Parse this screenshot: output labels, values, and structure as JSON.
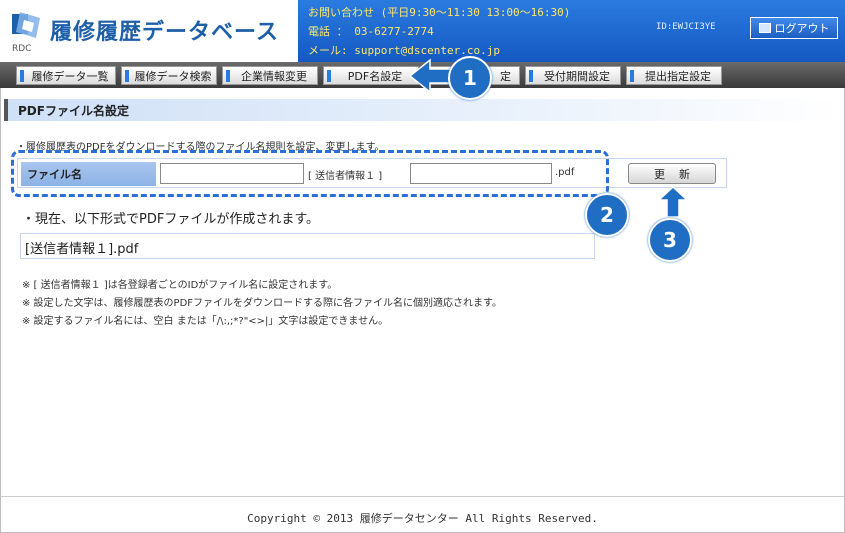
{
  "header": {
    "logo_title": "履修履歴データベース",
    "logo_sub": "RDC",
    "contact_hours": "お問い合わせ (平日9:30〜11:30 13:00〜16:30)",
    "contact_phone": "電話 ： 03-6277-2774",
    "contact_mail": "メール: support@dscenter.co.jp",
    "user_id": "ID:EWJCI3YE",
    "logout_label": "ログアウト"
  },
  "nav": {
    "tabs": [
      {
        "label": "履修データ一覧"
      },
      {
        "label": "履修データ検索"
      },
      {
        "label": "企業情報変更"
      },
      {
        "label": "PDF名設定"
      },
      {
        "label": "定"
      },
      {
        "label": "受付期間設定"
      },
      {
        "label": "提出指定設定"
      }
    ]
  },
  "section": {
    "title": "PDFファイル名設定",
    "description": "・履修履歴表のPDFをダウンロードする際のファイル名規則を設定、変更します。"
  },
  "form": {
    "label": "ファイル名",
    "prefix_value": "",
    "middle_text": "[ 送信者情報１ ]",
    "suffix_value": "",
    "extension": ".pdf",
    "update_label": "更新"
  },
  "preview": {
    "heading": "・現在、以下形式でPDFファイルが作成されます。",
    "value": "[送信者情報１].pdf"
  },
  "notes": [
    "※ [ 送信者情報１ ]は各登録者ごとのIDがファイル名に設定されます。",
    "※ 設定した文字は、履修履歴表のPDFファイルをダウンロードする際に各ファイル名に個別適応されます。",
    "※ 設定するファイル名には、空白 または「/\\:,;*?\"<>|」文字は設定できません。"
  ],
  "footer": {
    "copyright": "Copyright © 2013 履修データセンター All Rights Reserved."
  },
  "callouts": {
    "step1": "1",
    "step2": "2",
    "step3": "3"
  },
  "colors": {
    "brand_blue": "#1e6fd6",
    "contact_text": "#ffe86a",
    "callout": "#1f6ec4"
  }
}
